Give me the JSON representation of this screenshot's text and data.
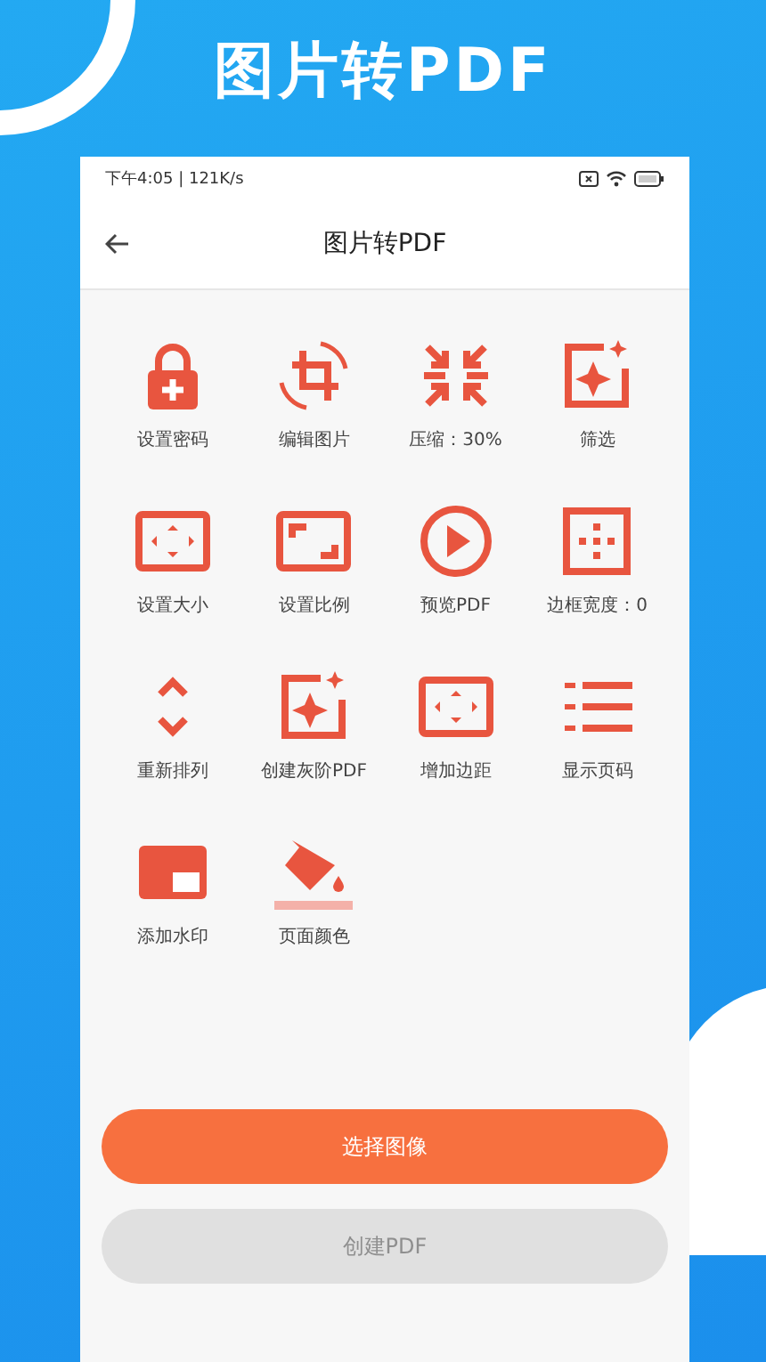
{
  "headline": "图片转PDF",
  "status_bar": {
    "time": "下午4:05 | 121K/s"
  },
  "header": {
    "title": "图片转PDF"
  },
  "tools": [
    {
      "label": "设置密码"
    },
    {
      "label": "编辑图片"
    },
    {
      "label": "压缩：30%"
    },
    {
      "label": "筛选"
    },
    {
      "label": "设置大小"
    },
    {
      "label": "设置比例"
    },
    {
      "label": "预览PDF"
    },
    {
      "label": "边框宽度：0"
    },
    {
      "label": "重新排列"
    },
    {
      "label": "创建灰阶PDF"
    },
    {
      "label": "增加边距"
    },
    {
      "label": "显示页码"
    },
    {
      "label": "添加水印"
    },
    {
      "label": "页面颜色"
    }
  ],
  "buttons": [
    {
      "label": "选择图像",
      "disabled": false
    },
    {
      "label": "创建PDF",
      "disabled": true
    }
  ]
}
